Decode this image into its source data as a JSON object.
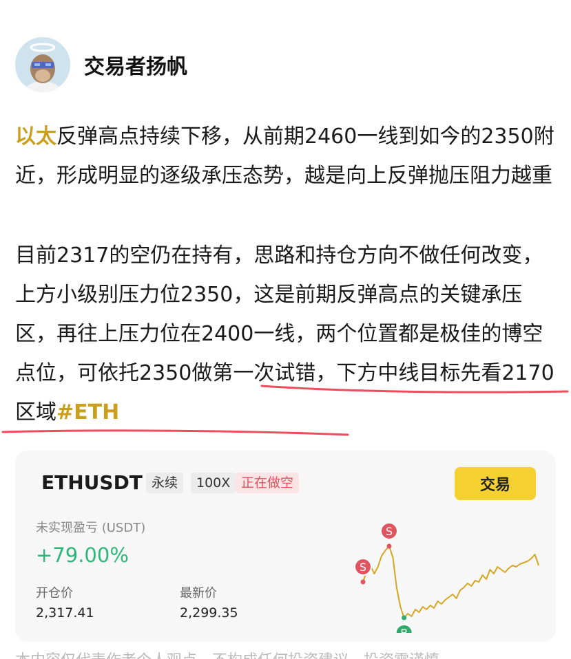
{
  "author": {
    "name": "交易者扬帆"
  },
  "post": {
    "p1": {
      "highlight": "以太",
      "text": "反弹高点持续下移，从前期2460一线到如今的2350附近，形成明显的逐级承压态势，越是向上反弹抛压阻力越重"
    },
    "p2": {
      "text": "目前2317的空仍在持有，思路和持仓方向不做任何改变，上方小级别压力位2350，这是前期反弹高点的关键承压区，再往上压力位在2400一线，两个位置都是极佳的博空点位，可依托2350做第一次试错，下方中线目标先看2170区域",
      "hashtag": "#ETH"
    }
  },
  "position_card": {
    "symbol": "ETHUSDT",
    "contract_type": "永续",
    "leverage": "100X",
    "side": "正在做空",
    "trade_button": "交易",
    "pnl_label": "未实现盈亏 (USDT)",
    "pnl_value": "+79.00%",
    "open_price_label": "开仓价",
    "open_price": "2,317.41",
    "last_price_label": "最新价",
    "last_price": "2,299.35",
    "markers": {
      "sell": "S",
      "buy": "B"
    }
  },
  "colors": {
    "accent_gold": "#c99f1d",
    "profit_green": "#2fb67a",
    "short_red": "#e0545f",
    "trade_yellow": "#f5d031",
    "underline_red": "#ee4c5c"
  },
  "chart_data": {
    "type": "line",
    "series": [
      {
        "values": [
          2322,
          2330,
          2334,
          2328,
          2333,
          2341,
          2345,
          2348,
          2340,
          2318,
          2304,
          2296,
          2299,
          2297,
          2302,
          2300,
          2304,
          2302,
          2305,
          2303,
          2308,
          2306,
          2309,
          2311,
          2313,
          2310,
          2316,
          2318,
          2321,
          2319,
          2323,
          2322,
          2327,
          2324,
          2331,
          2328,
          2333,
          2331,
          2329,
          2332,
          2334,
          2333,
          2335,
          2336,
          2337,
          2339,
          2342,
          2334
        ]
      }
    ],
    "markers": [
      {
        "label": "S",
        "index": 0,
        "side": "sell"
      },
      {
        "label": "S",
        "index": 7,
        "side": "sell"
      },
      {
        "label": "B",
        "index": 11,
        "side": "buy"
      }
    ]
  },
  "footer": {
    "partial_text": "本内容仅代表作者个人观点，不构成任何投资建议，投资需谨慎。"
  }
}
